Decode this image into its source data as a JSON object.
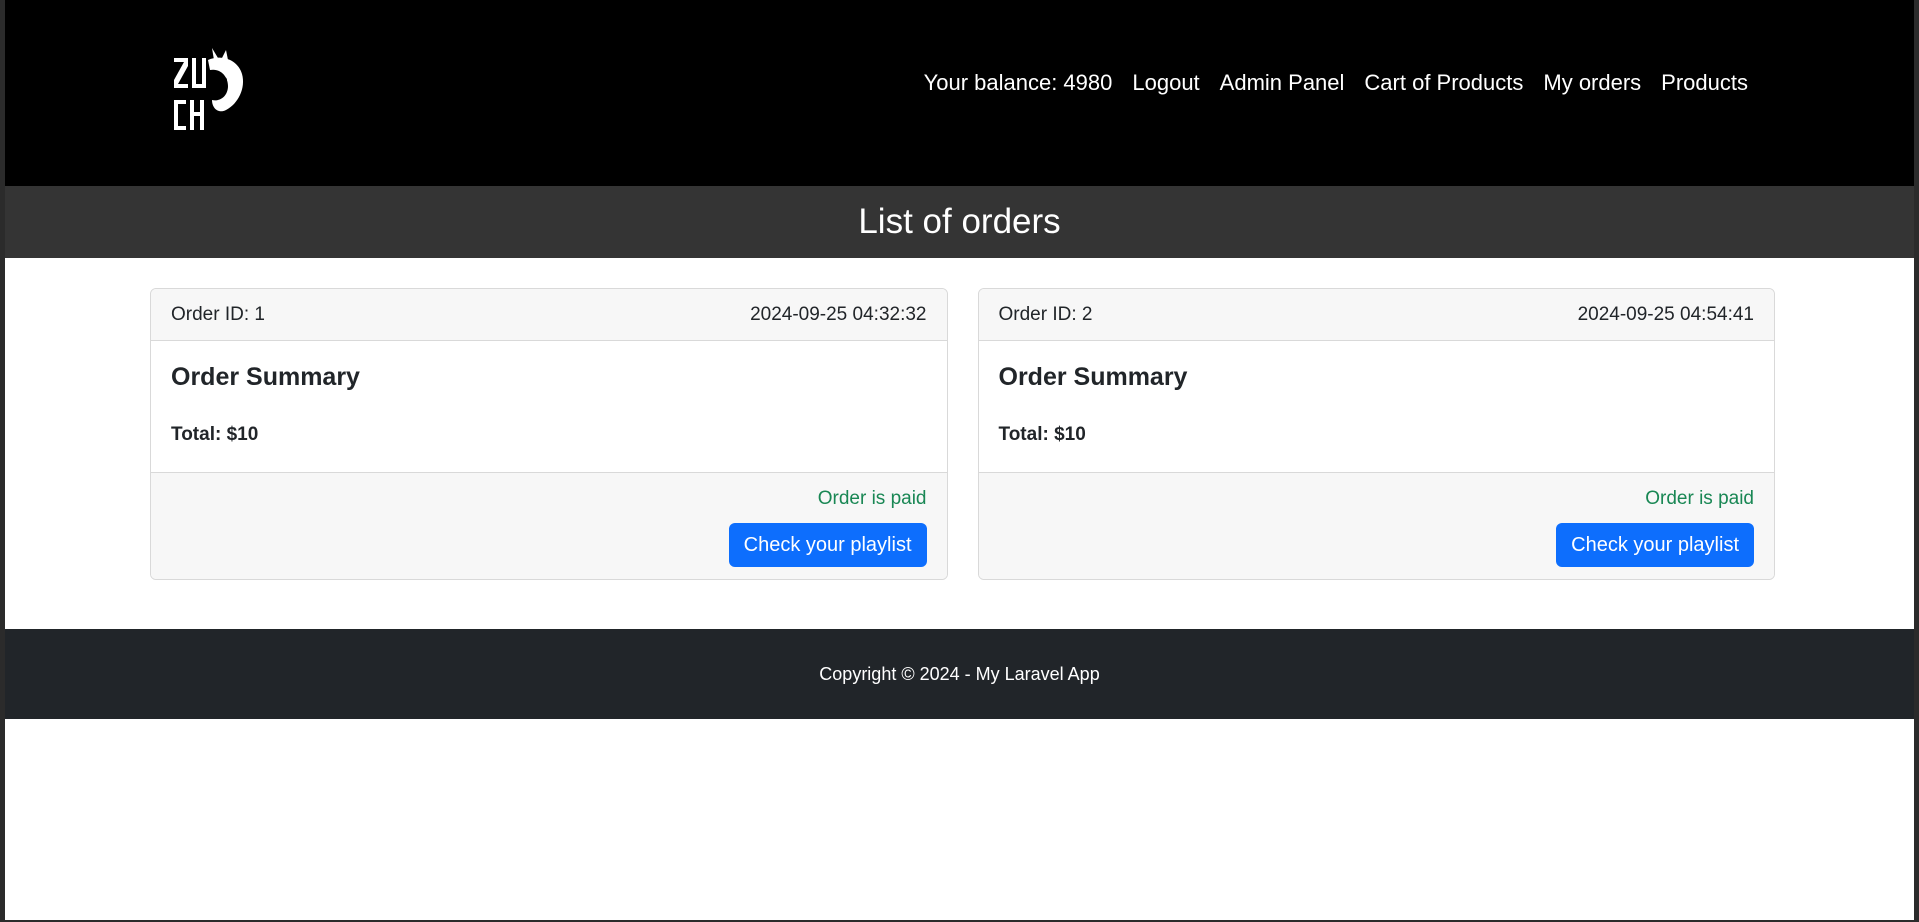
{
  "nav": {
    "balance": "Your balance: 4980",
    "links": [
      "Logout",
      "Admin Panel",
      "Cart of Products",
      "My orders",
      "Products"
    ]
  },
  "page": {
    "title": "List of orders"
  },
  "orders": [
    {
      "id_label": "Order ID: 1",
      "date": "2024-09-25 04:32:32",
      "summary_title": "Order Summary",
      "total": "Total: $10",
      "status": "Order is paid",
      "button": "Check your playlist"
    },
    {
      "id_label": "Order ID: 2",
      "date": "2024-09-25 04:54:41",
      "summary_title": "Order Summary",
      "total": "Total: $10",
      "status": "Order is paid",
      "button": "Check your playlist"
    }
  ],
  "footer": {
    "copyright": "Copyright © 2024 - My Laravel App"
  },
  "colors": {
    "navbar": "#000000",
    "title_bar": "#343434",
    "footer": "#212529",
    "primary_button": "#0d6efd",
    "success_text": "#198754"
  }
}
